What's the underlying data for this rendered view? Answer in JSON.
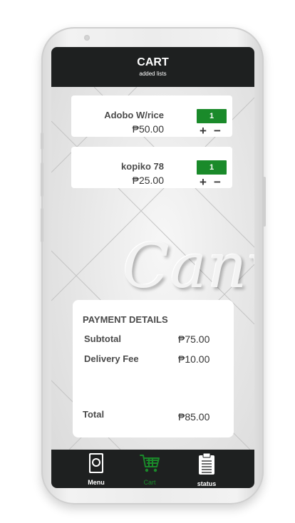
{
  "header": {
    "title": "CART",
    "subtitle": "added lists"
  },
  "cart_items": [
    {
      "name": "Adobo W/rice",
      "price": "₱50.00",
      "quantity": "1",
      "plus": "+",
      "minus": "−"
    },
    {
      "name": "kopiko 78",
      "price": "₱25.00",
      "quantity": "1",
      "plus": "+",
      "minus": "−"
    }
  ],
  "background_watermark": "Canv",
  "payment": {
    "title": "PAYMENT DETAILS",
    "subtotal_label": "Subtotal",
    "subtotal_value": "₱75.00",
    "delivery_label": "Delivery Fee",
    "delivery_value": "₱10.00",
    "total_label": "Total",
    "total_value": "₱85.00"
  },
  "nav": [
    {
      "label": "Menu",
      "icon": "menu-book-icon",
      "active": false
    },
    {
      "label": "Cart",
      "icon": "cart-icon",
      "active": true
    },
    {
      "label": "status",
      "icon": "clipboard-icon",
      "active": false
    }
  ],
  "colors": {
    "header_bg": "#1e2020",
    "accent_green": "#1a8a2a",
    "card_bg": "#ffffff",
    "screen_bg": "#e6e6e6"
  }
}
